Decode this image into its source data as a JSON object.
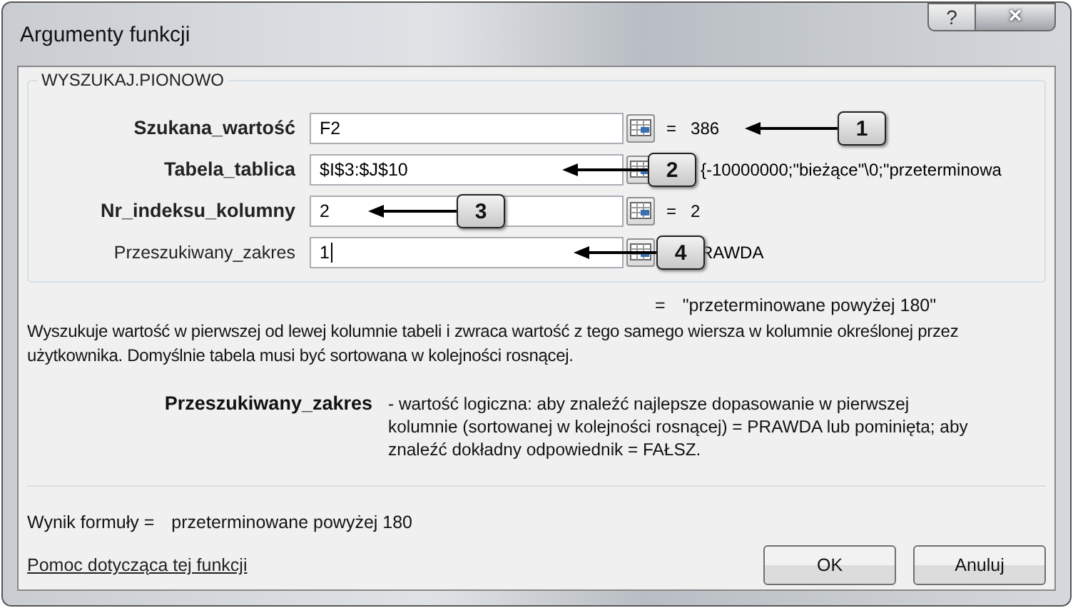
{
  "window": {
    "title": "Argumenty funkcji",
    "help_button": "?",
    "close_button": "×"
  },
  "function_group": {
    "name": "WYSZUKAJ.PIONOWO",
    "arguments": [
      {
        "label": "Szukana_wartość",
        "required": true,
        "value": "F2",
        "caret": false,
        "equals": "=",
        "result": "386",
        "callout": "1"
      },
      {
        "label": "Tabela_tablica",
        "required": true,
        "value": "$I$3:$J$10",
        "caret": false,
        "result": "{-10000000;\"bieżące\"\\0;\"przeterminowa",
        "callout": "2"
      },
      {
        "label": "Nr_indeksu_kolumny",
        "required": true,
        "value": "2",
        "caret": false,
        "equals": "=",
        "result": "2",
        "callout": "3"
      },
      {
        "label": "Przeszukiwany_zakres",
        "required": false,
        "value": "1",
        "caret": true,
        "result": "RAWDA",
        "callout": "4"
      }
    ]
  },
  "function_result": {
    "equals": "=",
    "value": "\"przeterminowane powyżej 180\""
  },
  "description": "Wyszukuje wartość w pierwszej od lewej kolumnie tabeli i zwraca wartość z tego samego wiersza w kolumnie określonej przez użytkownika. Domyślnie tabela musi być sortowana w kolejności rosnącej.",
  "argument_help": {
    "name": "Przeszukiwany_zakres",
    "text": "- wartość logiczna: aby znaleźć najlepsze dopasowanie w pierwszej kolumnie (sortowanej w kolejności rosnącej) = PRAWDA lub pominięta; aby znaleźć dokładny odpowiednik = FAŁSZ."
  },
  "formula_result": {
    "label": "Wynik formuły =",
    "value": "przeterminowane powyżej 180"
  },
  "help_link": "Pomoc dotycząca tej funkcji",
  "buttons": [
    "OK",
    "Anuluj"
  ]
}
